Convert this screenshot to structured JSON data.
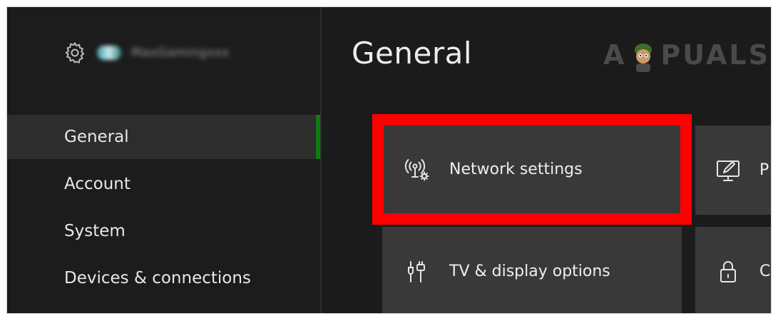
{
  "sidebar": {
    "gamertag": "MaxGamingxxx",
    "items": [
      {
        "label": "General",
        "active": true
      },
      {
        "label": "Account",
        "active": false
      },
      {
        "label": "System",
        "active": false
      },
      {
        "label": "Devices & connections",
        "active": false
      }
    ]
  },
  "main": {
    "title": "General",
    "tiles": [
      {
        "label": "Network settings",
        "icon": "network-settings-icon"
      },
      {
        "label": "TV & display options",
        "icon": "tv-display-icon"
      },
      {
        "label": "P",
        "icon": "personalization-icon"
      },
      {
        "label": "C",
        "icon": "lock-icon"
      }
    ]
  },
  "watermark": {
    "left": "A",
    "right": "PUALS"
  },
  "colors": {
    "accent": "#107c10",
    "highlight": "#ff0000",
    "background": "#1b1b1b",
    "tile": "#393939"
  }
}
